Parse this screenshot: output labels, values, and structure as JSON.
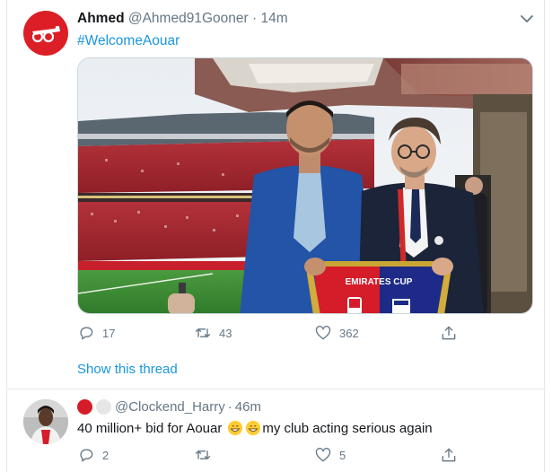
{
  "tweet": {
    "display_name": "Ahmed",
    "handle": "@Ahmed91Gooner",
    "separator": "·",
    "time": "14m",
    "text": "#WelcomeAouar",
    "image": {
      "banner_text": "EMIRATES CUP"
    },
    "actions": {
      "reply_count": "17",
      "retweet_count": "43",
      "like_count": "362",
      "share_count": ""
    },
    "show_thread_label": "Show this thread"
  },
  "reply": {
    "handle": "@Clockend_Harry",
    "separator": "·",
    "time": "46m",
    "text_before": "40 million+ bid for Aouar",
    "text_after": "my club acting serious again",
    "actions": {
      "reply_count": "2",
      "retweet_count": "",
      "like_count": "5",
      "share_count": ""
    }
  },
  "icons": {
    "avatar_main": "arsenal-cannon-icon",
    "caret": "chevron-down-icon",
    "reply": "reply-icon",
    "retweet": "retweet-icon",
    "like": "heart-icon",
    "share": "share-icon",
    "emoji": "grinning-emoji-icon"
  },
  "colors": {
    "link": "#1b95e0",
    "muted": "#657786",
    "arsenal_red": "#dc1f26"
  }
}
